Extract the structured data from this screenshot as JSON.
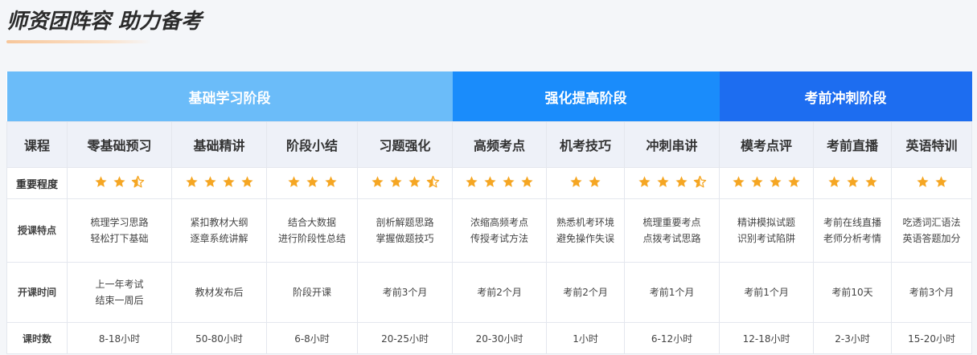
{
  "heading": {
    "title": "师资团阵容 助力备考"
  },
  "colors": {
    "stage_1": "#6bbcf9",
    "stage_2": "#1a8cfb",
    "stage_3": "#1d6df0",
    "star": "#f5a623"
  },
  "stages": [
    {
      "label": "基础学习阶段"
    },
    {
      "label": "强化提高阶段"
    },
    {
      "label": "考前冲刺阶段"
    }
  ],
  "row_labels": {
    "course": "课程",
    "importance": "重要程度",
    "features": "授课特点",
    "start_time": "开课时间",
    "hours": "课时数"
  },
  "courses": [
    {
      "name": "零基础预习",
      "stars": 2.5,
      "feature_1": "梳理学习思路",
      "feature_2": "轻松打下基础",
      "time_1": "上一年考试",
      "time_2": "结束一周后",
      "hours": "8-18小时"
    },
    {
      "name": "基础精讲",
      "stars": 4,
      "feature_1": "紧扣教材大纲",
      "feature_2": "逐章系统讲解",
      "time_1": "教材发布后",
      "time_2": "",
      "hours": "50-80小时"
    },
    {
      "name": "阶段小结",
      "stars": 3,
      "feature_1": "结合大数据",
      "feature_2": "进行阶段性总结",
      "time_1": "阶段开课",
      "time_2": "",
      "hours": "6-8小时"
    },
    {
      "name": "习题强化",
      "stars": 3.5,
      "feature_1": "剖析解题思路",
      "feature_2": "掌握做题技巧",
      "time_1": "考前3个月",
      "time_2": "",
      "hours": "20-25小时"
    },
    {
      "name": "高频考点",
      "stars": 4,
      "feature_1": "浓缩高频考点",
      "feature_2": "传授考试方法",
      "time_1": "考前2个月",
      "time_2": "",
      "hours": "20-30小时"
    },
    {
      "name": "机考技巧",
      "stars": 2,
      "feature_1": "熟悉机考环境",
      "feature_2": "避免操作失误",
      "time_1": "考前2个月",
      "time_2": "",
      "hours": "1小时"
    },
    {
      "name": "冲刺串讲",
      "stars": 3.5,
      "feature_1": "梳理重要考点",
      "feature_2": "点拨考试思路",
      "time_1": "考前1个月",
      "time_2": "",
      "hours": "6-12小时"
    },
    {
      "name": "模考点评",
      "stars": 4,
      "feature_1": "精讲模拟试题",
      "feature_2": "识别考试陷阱",
      "time_1": "考前1个月",
      "time_2": "",
      "hours": "12-18小时"
    },
    {
      "name": "考前直播",
      "stars": 3,
      "feature_1": "考前在线直播",
      "feature_2": "老师分析考情",
      "time_1": "考前10天",
      "time_2": "",
      "hours": "2-3小时"
    },
    {
      "name": "英语特训",
      "stars": 2,
      "feature_1": "吃透词汇语法",
      "feature_2": "英语答题加分",
      "time_1": "考前3个月",
      "time_2": "",
      "hours": "15-20小时"
    }
  ]
}
